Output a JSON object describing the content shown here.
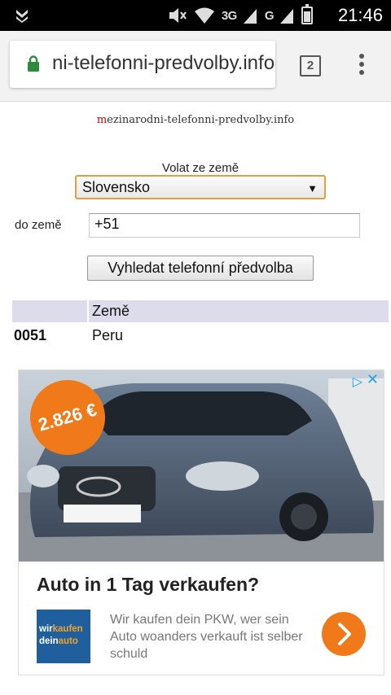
{
  "status_bar": {
    "time": "21:46",
    "network_1": "3G",
    "network_2": "G",
    "sim_1": "1",
    "sim_2": "2"
  },
  "browser": {
    "url": "ni-telefonni-predvolby.info",
    "tab_count": "2"
  },
  "page": {
    "site_name_first": "m",
    "site_name_rest": "ezinarodni-telefonni-predvolby.info",
    "from_label": "Volat ze země",
    "from_selected": "Slovensko",
    "to_label": "do země",
    "code_value": "+51",
    "search_button": "Vyhledat telefonní předvolba",
    "results": {
      "header_country": "Země",
      "rows": [
        {
          "code": "0051",
          "country": "Peru"
        }
      ]
    }
  },
  "ad": {
    "price_badge": "2.826 €",
    "title": "Auto in 1 Tag verkaufen?",
    "logo_line1_a": "wir",
    "logo_line1_b": "kaufen",
    "logo_line2_a": "dein",
    "logo_line2_b": "auto",
    "description": "Wir kaufen dein PKW, wer sein Auto woanders verkauft ist selber schuld",
    "colors": {
      "accent": "#f07a1a",
      "logo_bg": "#1f5f9e",
      "adchoices": "#1da1f2"
    }
  },
  "colors": {
    "table_header": "#dcdcec",
    "select_border": "#e0a040",
    "lock": "#2e8b3e"
  }
}
